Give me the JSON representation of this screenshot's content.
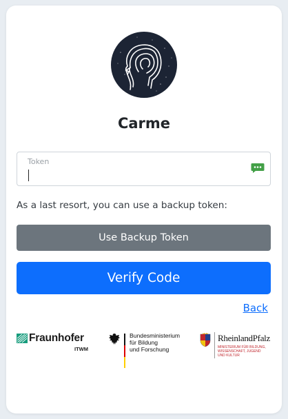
{
  "app": {
    "title": "Carme"
  },
  "token_field": {
    "label": "Token",
    "value": "",
    "icon": "sms-icon"
  },
  "backup": {
    "hint": "As a last resort, you can use a backup token:",
    "button_label": "Use Backup Token"
  },
  "verify": {
    "button_label": "Verify Code"
  },
  "back": {
    "label": "Back"
  },
  "partners": {
    "fraunhofer": {
      "name": "Fraunhofer",
      "sub": "ITWM"
    },
    "bmbf": {
      "lines": [
        "Bundesministerium",
        "für Bildung",
        "und Forschung"
      ]
    },
    "rlp": {
      "name": "RheinlandPfalz",
      "lines": [
        "MINISTERIUM FÜR BILDUNG,",
        "WISSENSCHAFT, JUGEND",
        "UND KULTUR"
      ]
    }
  },
  "colors": {
    "primary": "#0d6efd",
    "secondary": "#6c757d",
    "sms_icon": "#43a047",
    "logo_bg": "#1c2434"
  }
}
